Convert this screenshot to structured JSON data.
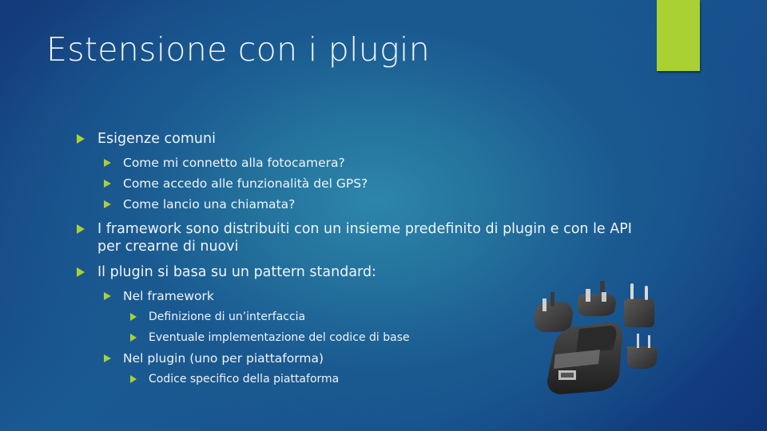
{
  "slide": {
    "title": "Estensione con i plugin",
    "colors": {
      "accent": "#a9d134",
      "text": "#f0f4f8",
      "background_dark": "#143a7a",
      "background_light": "#2d86ab"
    },
    "bullets": [
      {
        "level": 1,
        "text": "Esigenze comuni"
      },
      {
        "level": 2,
        "text": "Come mi connetto alla fotocamera?"
      },
      {
        "level": 2,
        "text": "Come accedo alle funzionalità del GPS?"
      },
      {
        "level": 2,
        "text": "Come lancio una chiamata?"
      },
      {
        "level": 1,
        "text": "I framework sono distribuiti con un insieme predefinito di plugin e con le API per crearne di nuovi"
      },
      {
        "level": 1,
        "text": "Il plugin si basa su un pattern standard:"
      },
      {
        "level": 2,
        "text": "Nel framework"
      },
      {
        "level": 3,
        "text": "Definizione di un’interfaccia"
      },
      {
        "level": 3,
        "text": "Eventuale implementazione del codice di base"
      },
      {
        "level": 2,
        "text": "Nel plugin (uno per piattaforma)"
      },
      {
        "level": 3,
        "text": "Codice specifico della piattaforma"
      }
    ],
    "image": {
      "icon": "power-adapter-with-plugs-icon"
    }
  }
}
